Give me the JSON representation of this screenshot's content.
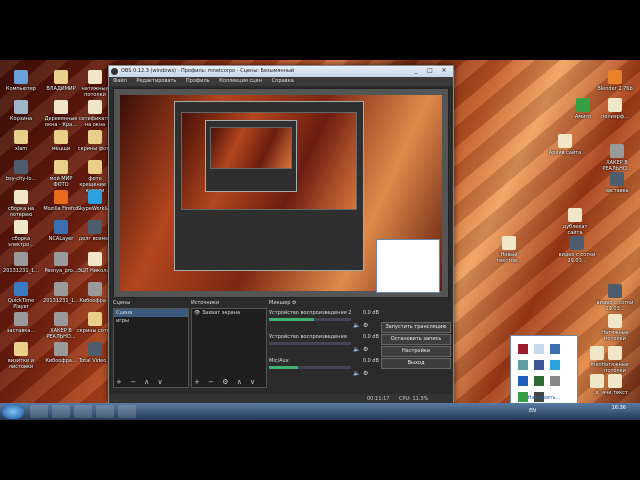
{
  "desktop_icons": [
    {
      "label": "Компьютер",
      "color": "#6aa0d8"
    },
    {
      "label": "ВЛАДИМИР",
      "color": "#e9d08a"
    },
    {
      "label": "натяжные потолки",
      "color": "#f0e6c8"
    },
    {
      "label": "Корзина",
      "color": "#9fb7c9"
    },
    {
      "label": "Деревянные окна - Кра...",
      "color": "#f0e6c8"
    },
    {
      "label": "сетификаты на окна",
      "color": "#f0e6c8"
    },
    {
      "label": "xlam",
      "color": "#e9d08a"
    },
    {
      "label": "мецщи",
      "color": "#e9d08a"
    },
    {
      "label": "скрины фото",
      "color": "#e9d08a"
    },
    {
      "label": "bsy-city-lo...",
      "color": "#4d5d6d"
    },
    {
      "label": "мой МИР ФОТО",
      "color": "#e9d08a"
    },
    {
      "label": "фото крещение в купели",
      "color": "#e9d08a"
    },
    {
      "label": "сборка на лотерею",
      "color": "#f0e6c8"
    },
    {
      "label": "Mozilla Firefox",
      "color": "#e86a1c"
    },
    {
      "label": "SkypeWork&...",
      "color": "#2aa2e0"
    },
    {
      "label": "сборка электро...",
      "color": "#f0e6c8"
    },
    {
      "label": "NCALayer",
      "color": "#3a6fb0"
    },
    {
      "label": "делг всемер",
      "color": "#4d5d6d"
    },
    {
      "label": "20131231_1...",
      "color": "#9a9a9a"
    },
    {
      "label": "Pesnya_pro...",
      "color": "#9a9a9a"
    },
    {
      "label": "ЭЦП Николай",
      "color": "#f0e6c8"
    },
    {
      "label": "QuickTime Player",
      "color": "#3a7ac0"
    },
    {
      "label": "20131231_1...",
      "color": "#9a9a9a"
    },
    {
      "label": "Кибоофра...",
      "color": "#9a9a9a"
    },
    {
      "label": "заставка...",
      "color": "#9a9a9a"
    },
    {
      "label": "ХАКЕР В РЕАЛЬНО...",
      "color": "#9a9a9a"
    },
    {
      "label": "скрины сотки",
      "color": "#e9d08a"
    },
    {
      "label": "визитки и листовки",
      "color": "#e9d08a"
    },
    {
      "label": "Кибоофра...",
      "color": "#9a9a9a"
    },
    {
      "label": "Total Video...",
      "color": "#4d5d6d"
    },
    {
      "label": "Blender 2.76b",
      "color": "#e8812a"
    },
    {
      "label": "Амиго",
      "color": "#35a043"
    },
    {
      "label": "полиэрф...",
      "color": "#f0e6c8"
    },
    {
      "label": "Архив сайта",
      "color": "#f0e6c8"
    },
    {
      "label": "ХАКЕР В РЕАЛЬНО...",
      "color": "#9a9a9a"
    },
    {
      "label": "заставка",
      "color": "#4d5d6d"
    },
    {
      "label": "дублекат сайта",
      "color": "#f0e6c8"
    },
    {
      "label": "Новый текстов...",
      "color": "#f0e6c8"
    },
    {
      "label": "видео с сотки 29.03...",
      "color": "#4d5d6d"
    },
    {
      "label": "видео с сотки 29.03...",
      "color": "#4d5d6d"
    },
    {
      "label": "Натяжные потолки",
      "color": "#f0e6c8"
    },
    {
      "label": "Натяжные потолки",
      "color": "#f0e6c8"
    },
    {
      "label": "ачи текст",
      "color": "#f0e6c8"
    },
    {
      "label": "ment",
      "color": "#f0e6c8"
    },
    {
      "label": "д",
      "color": "#f0e6c8"
    }
  ],
  "obs": {
    "title": "OBS 0.12.3 (windows) - Профиль: mnetcorpo - Сцены: Безымянный",
    "menu": [
      "Файл",
      "Редактировать",
      "Профиль",
      "Коллекция сцен",
      "Справка"
    ],
    "scenes_label": "Сцены",
    "scenes": [
      "Сцена",
      "игры"
    ],
    "sources_label": "Источники",
    "sources": [
      "Захват экрана"
    ],
    "mixer_label": "Микшер",
    "mixer": [
      {
        "label": "Устройство воспроизведения 2",
        "db": "0.0 dB",
        "level": 0.55
      },
      {
        "label": "Устройство воспроизведения",
        "db": "0.0 dB",
        "level": 0.0
      },
      {
        "label": "Mic/Aux",
        "db": "0.0 dB",
        "level": 0.35
      }
    ],
    "buttons": [
      "Запустить трансляцию",
      "Остановить запись",
      "Настройки",
      "Выход"
    ],
    "status_time": "00:11:17",
    "status_cpu": "CPU: 11.3%",
    "tools": "+ − ∧ ∨"
  },
  "tray": {
    "link": "Настроить..."
  },
  "taskbar": {
    "lang": "EN",
    "clock": "16:36"
  }
}
